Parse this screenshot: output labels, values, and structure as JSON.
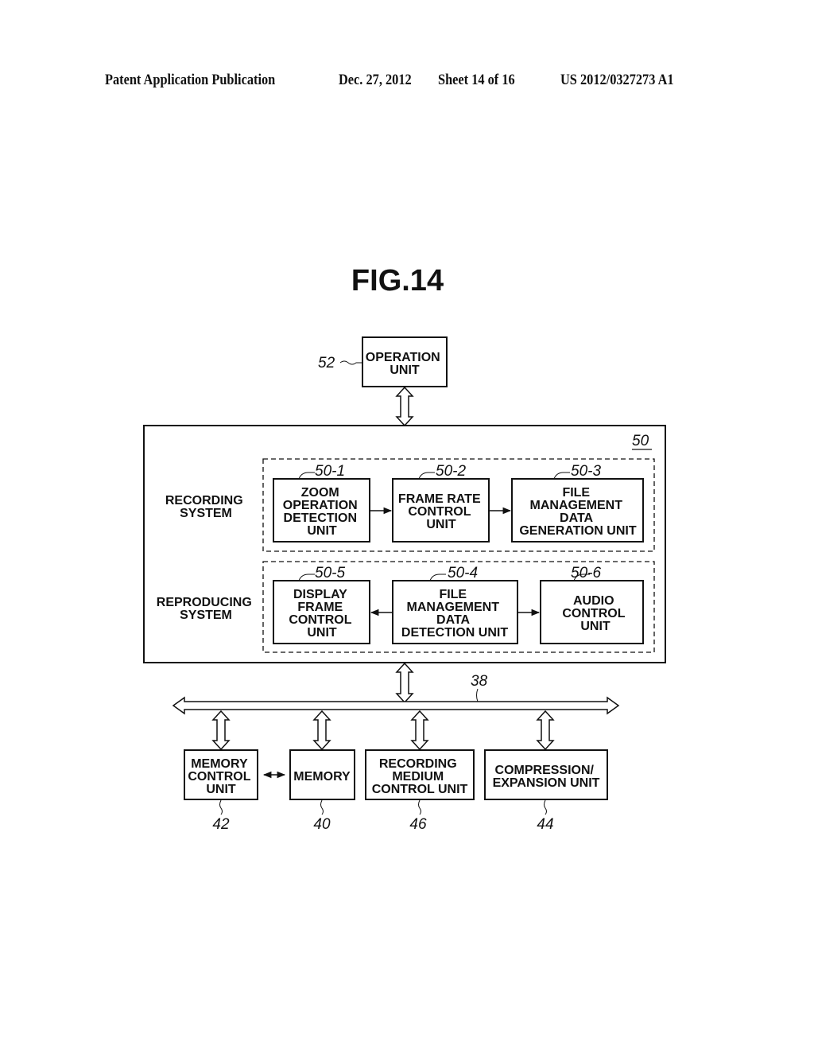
{
  "header": {
    "publication": "Patent Application Publication",
    "date": "Dec. 27, 2012",
    "sheet": "Sheet 14 of 16",
    "number": "US 2012/0327273 A1"
  },
  "figure": {
    "title": "FIG.14"
  },
  "operation_unit": {
    "ref": "52",
    "lines": [
      "OPERATION",
      "UNIT"
    ]
  },
  "controller": {
    "ref": "50"
  },
  "recording_system": {
    "label": [
      "RECORDING",
      "SYSTEM"
    ],
    "blocks": [
      {
        "ref": "50-1",
        "lines": [
          "ZOOM",
          "OPERATION",
          "DETECTION",
          "UNIT"
        ]
      },
      {
        "ref": "50-2",
        "lines": [
          "FRAME RATE",
          "CONTROL",
          "UNIT"
        ]
      },
      {
        "ref": "50-3",
        "lines": [
          "FILE",
          "MANAGEMENT",
          "DATA",
          "GENERATION UNIT"
        ]
      }
    ]
  },
  "reproducing_system": {
    "label": [
      "REPRODUCING",
      "SYSTEM"
    ],
    "blocks": [
      {
        "ref": "50-5",
        "lines": [
          "DISPLAY",
          "FRAME",
          "CONTROL",
          "UNIT"
        ]
      },
      {
        "ref": "50-4",
        "lines": [
          "FILE",
          "MANAGEMENT",
          "DATA",
          "DETECTION UNIT"
        ]
      },
      {
        "ref": "50-6",
        "lines": [
          "AUDIO",
          "CONTROL",
          "UNIT"
        ]
      }
    ]
  },
  "bus": {
    "ref": "38"
  },
  "peripherals": [
    {
      "ref": "42",
      "lines": [
        "MEMORY",
        "CONTROL",
        "UNIT"
      ]
    },
    {
      "ref": "40",
      "lines": [
        "MEMORY"
      ]
    },
    {
      "ref": "46",
      "lines": [
        "RECORDING",
        "MEDIUM",
        "CONTROL UNIT"
      ]
    },
    {
      "ref": "44",
      "lines": [
        "COMPRESSION/",
        "EXPANSION UNIT"
      ]
    }
  ]
}
